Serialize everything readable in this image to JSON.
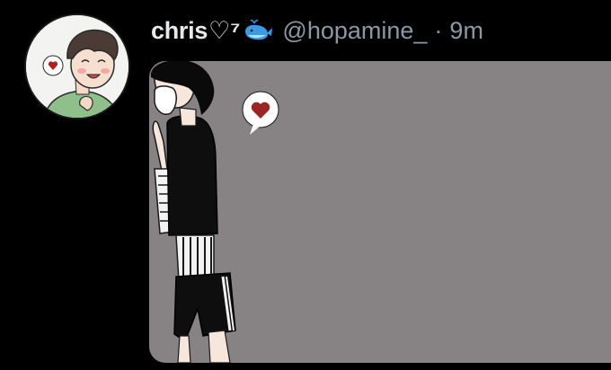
{
  "tweet": {
    "author": {
      "display_name": "chris",
      "name_suffix": "♡⁷",
      "emoji": "whale-icon",
      "handle": "@hopamine_"
    },
    "separator": "·",
    "timestamp": "9m",
    "media": {
      "background_color": "#878284",
      "heart_color": "#9b2424"
    }
  }
}
